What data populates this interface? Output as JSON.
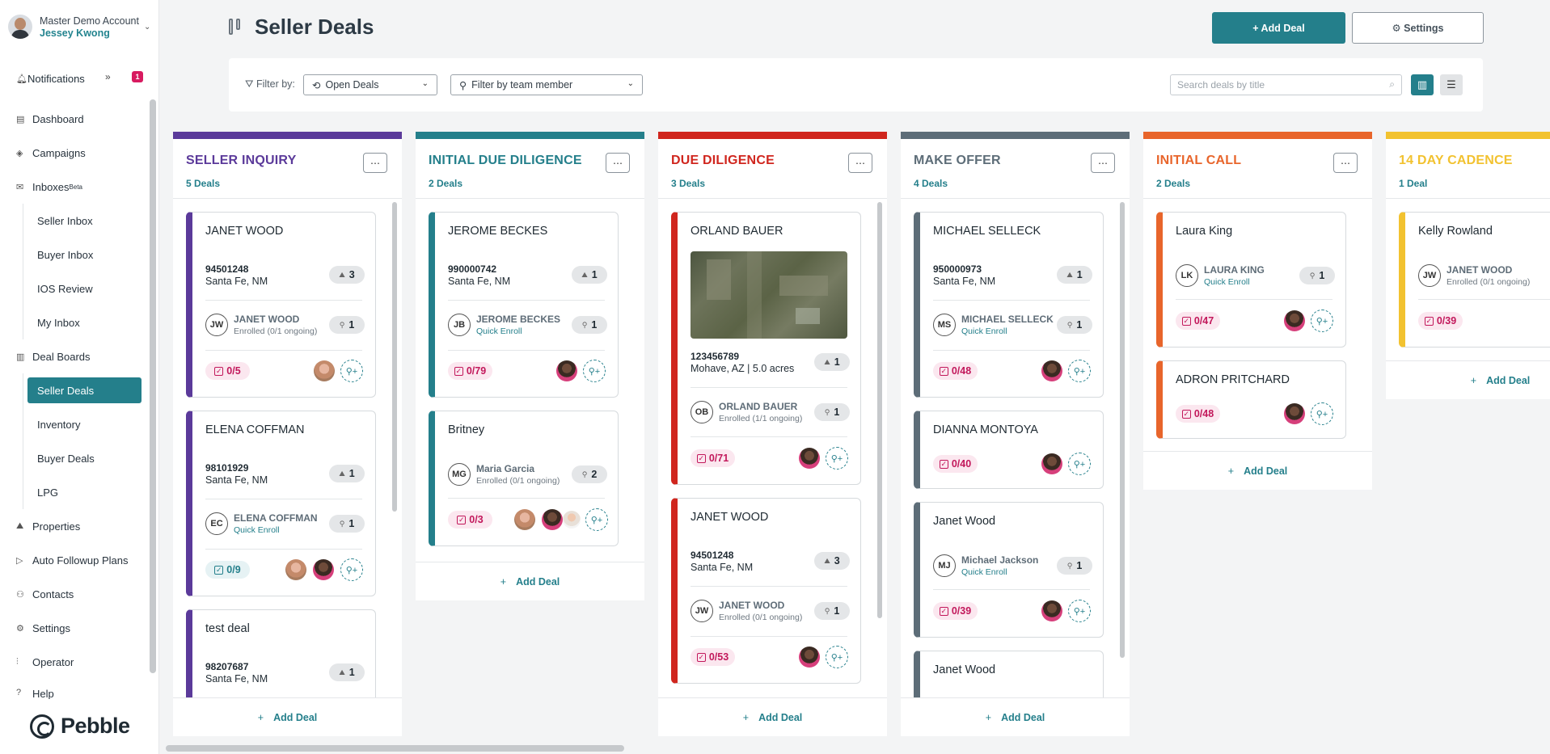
{
  "account": {
    "name": "Master Demo Account",
    "user": "Jessey Kwong"
  },
  "notifications": {
    "label": "Notifications",
    "count": "1"
  },
  "nav": {
    "dashboard": "Dashboard",
    "campaigns": "Campaigns",
    "inboxes": "Inboxes",
    "inboxes_badge": "Beta",
    "seller_inbox": "Seller Inbox",
    "buyer_inbox": "Buyer Inbox",
    "ios_review": "IOS Review",
    "my_inbox": "My Inbox",
    "deal_boards": "Deal Boards",
    "seller_deals": "Seller Deals",
    "inventory": "Inventory",
    "buyer_deals": "Buyer Deals",
    "lpg": "LPG",
    "properties": "Properties",
    "auto_followup": "Auto Followup Plans",
    "contacts": "Contacts",
    "settings": "Settings",
    "operator": "Operator",
    "help": "Help"
  },
  "brand": "Pebble",
  "header": {
    "title": "Seller Deals",
    "add_deal": "+ Add Deal",
    "settings": "⚙ Settings"
  },
  "filter": {
    "label": "Filter by:",
    "status": "Open Deals",
    "team": "Filter by team member",
    "search_placeholder": "Search deals by title"
  },
  "add_deal_label": "Add Deal",
  "colors": {
    "accent": "#247f8b",
    "purple": "#5b3a9a",
    "teal": "#247f8b",
    "red": "#d0261e",
    "slate": "#5d6d78",
    "orange": "#e8652b",
    "yellow": "#f2c230"
  },
  "columns": [
    {
      "title": "SELLER INQUIRY",
      "count": "5 Deals",
      "cards": [
        {
          "name": "JANET WOOD",
          "zip": "94501248",
          "city": "Santa Fe, NM",
          "props": "3",
          "initials": "JW",
          "contact": "JANET WOOD",
          "contact_sub": "Enrolled (0/1 ongoing)",
          "contact_count": "1",
          "tasks": "0/5"
        },
        {
          "name": "ELENA COFFMAN",
          "zip": "98101929",
          "city": "Santa Fe, NM",
          "props": "1",
          "initials": "EC",
          "contact": "ELENA COFFMAN",
          "contact_sub": "Quick Enroll",
          "contact_count": "1",
          "tasks": "0/9"
        },
        {
          "name": "test deal",
          "zip": "98207687",
          "city": "Santa Fe, NM",
          "props": "1"
        }
      ]
    },
    {
      "title": "INITIAL DUE DILIGENCE",
      "count": "2 Deals",
      "cards": [
        {
          "name": "JEROME BECKES",
          "zip": "990000742",
          "city": "Santa Fe, NM",
          "props": "1",
          "initials": "JB",
          "contact": "JEROME BECKES",
          "contact_sub": "Quick Enroll",
          "contact_count": "1",
          "tasks": "0/79"
        },
        {
          "name": "Britney",
          "initials": "MG",
          "contact": "Maria Garcia",
          "contact_sub": "Enrolled (0/1 ongoing)",
          "contact_count": "2",
          "tasks": "0/3"
        }
      ]
    },
    {
      "title": "DUE DILIGENCE",
      "count": "3 Deals",
      "cards": [
        {
          "name": "ORLAND BAUER",
          "zip": "123456789",
          "city": "Mohave, AZ | 5.0 acres",
          "props": "1",
          "initials": "OB",
          "contact": "ORLAND BAUER",
          "contact_sub": "Enrolled (1/1 ongoing)",
          "contact_count": "1",
          "tasks": "0/71"
        },
        {
          "name": "JANET WOOD",
          "zip": "94501248",
          "city": "Santa Fe, NM",
          "props": "3",
          "initials": "JW",
          "contact": "JANET WOOD",
          "contact_sub": "Enrolled (0/1 ongoing)",
          "contact_count": "1",
          "tasks": "0/53"
        }
      ]
    },
    {
      "title": "MAKE OFFER",
      "count": "4 Deals",
      "cards": [
        {
          "name": "MICHAEL SELLECK",
          "zip": "950000973",
          "city": "Santa Fe, NM",
          "props": "1",
          "initials": "MS",
          "contact": "MICHAEL SELLECK",
          "contact_sub": "Quick Enroll",
          "contact_count": "1",
          "tasks": "0/48"
        },
        {
          "name": "DIANNA MONTOYA",
          "tasks": "0/40"
        },
        {
          "name": "Janet Wood",
          "initials": "MJ",
          "contact": "Michael Jackson",
          "contact_sub": "Quick Enroll",
          "contact_count": "1",
          "tasks": "0/39"
        },
        {
          "name": "Janet Wood"
        }
      ]
    },
    {
      "title": "INITIAL CALL",
      "count": "2 Deals",
      "cards": [
        {
          "name": "Laura King",
          "initials": "LK",
          "contact": "LAURA KING",
          "contact_sub": "Quick Enroll",
          "contact_count": "1",
          "tasks": "0/47"
        },
        {
          "name": "ADRON PRITCHARD",
          "tasks": "0/48"
        }
      ]
    },
    {
      "title": "14 DAY CADENCE",
      "count": "1 Deal",
      "cards": [
        {
          "name": "Kelly Rowland",
          "initials": "JW",
          "contact": "JANET WOOD",
          "contact_sub": "Enrolled (0/1 ongoing)",
          "tasks": "0/39"
        }
      ]
    }
  ]
}
